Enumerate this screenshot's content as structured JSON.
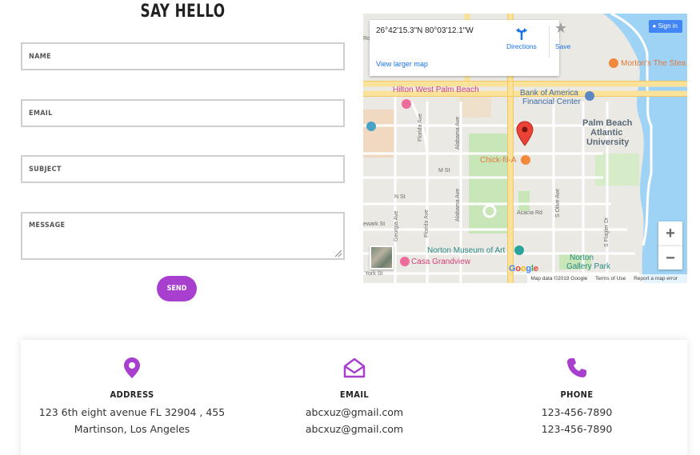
{
  "form": {
    "title": "SAY HELLO",
    "name_placeholder": "NAME",
    "email_placeholder": "EMAIL",
    "subject_placeholder": "SUBJECT",
    "message_placeholder": "MESSAGE",
    "send_label": "SEND"
  },
  "map": {
    "coords": "26°42'15.3\"N 80°03'12.1\"W",
    "directions_label": "Directions",
    "save_label": "Save",
    "view_larger": "View larger map",
    "signin_label": "Sign in",
    "zoom_in": "+",
    "zoom_out": "−",
    "attribution": {
      "data": "Map data ©2019 Google",
      "terms": "Terms of Use",
      "report": "Report a map error"
    },
    "labels": {
      "hilton": "Hilton West Palm Beach",
      "boa_1": "Bank of America",
      "boa_2": "Financial Center",
      "pba_1": "Palm Beach",
      "pba_2": "Atlantic",
      "pba_3": "University",
      "chickfila": "Chick-fil-A",
      "mortons": "Morton's The Stea",
      "norton_museum": "Norton Museum of Art",
      "casa": "Casa Grandview",
      "norton_park_1": "Norton",
      "norton_park_2": "Gallery Park",
      "n_st": "N St",
      "m_st": "M St",
      "acacia": "Acacia Rd",
      "york": "York St",
      "ewark": "ewark St",
      "florida_ave": "Florida Ave",
      "alabama_ave": "Alabama Ave",
      "georgia_ave": "Georgia Ave",
      "olive_ave": "S Olive Ave",
      "flagler": "S Flagler Dr",
      "ro": "Ro"
    }
  },
  "contact": {
    "address": {
      "title": "ADDRESS",
      "line1": "123 6th eight avenue FL 32904 , 455",
      "line2": "Martinson, Los Angeles"
    },
    "email": {
      "title": "EMAIL",
      "line1": "abcxuz@gmail.com",
      "line2": "abcxuz@gmail.com"
    },
    "phone": {
      "title": "PHONE",
      "line1": "123-456-7890",
      "line2": "123-456-7890"
    }
  },
  "colors": {
    "accent": "#a83fcf",
    "water": "#9fd3f5",
    "major_road": "#fbe29b"
  }
}
